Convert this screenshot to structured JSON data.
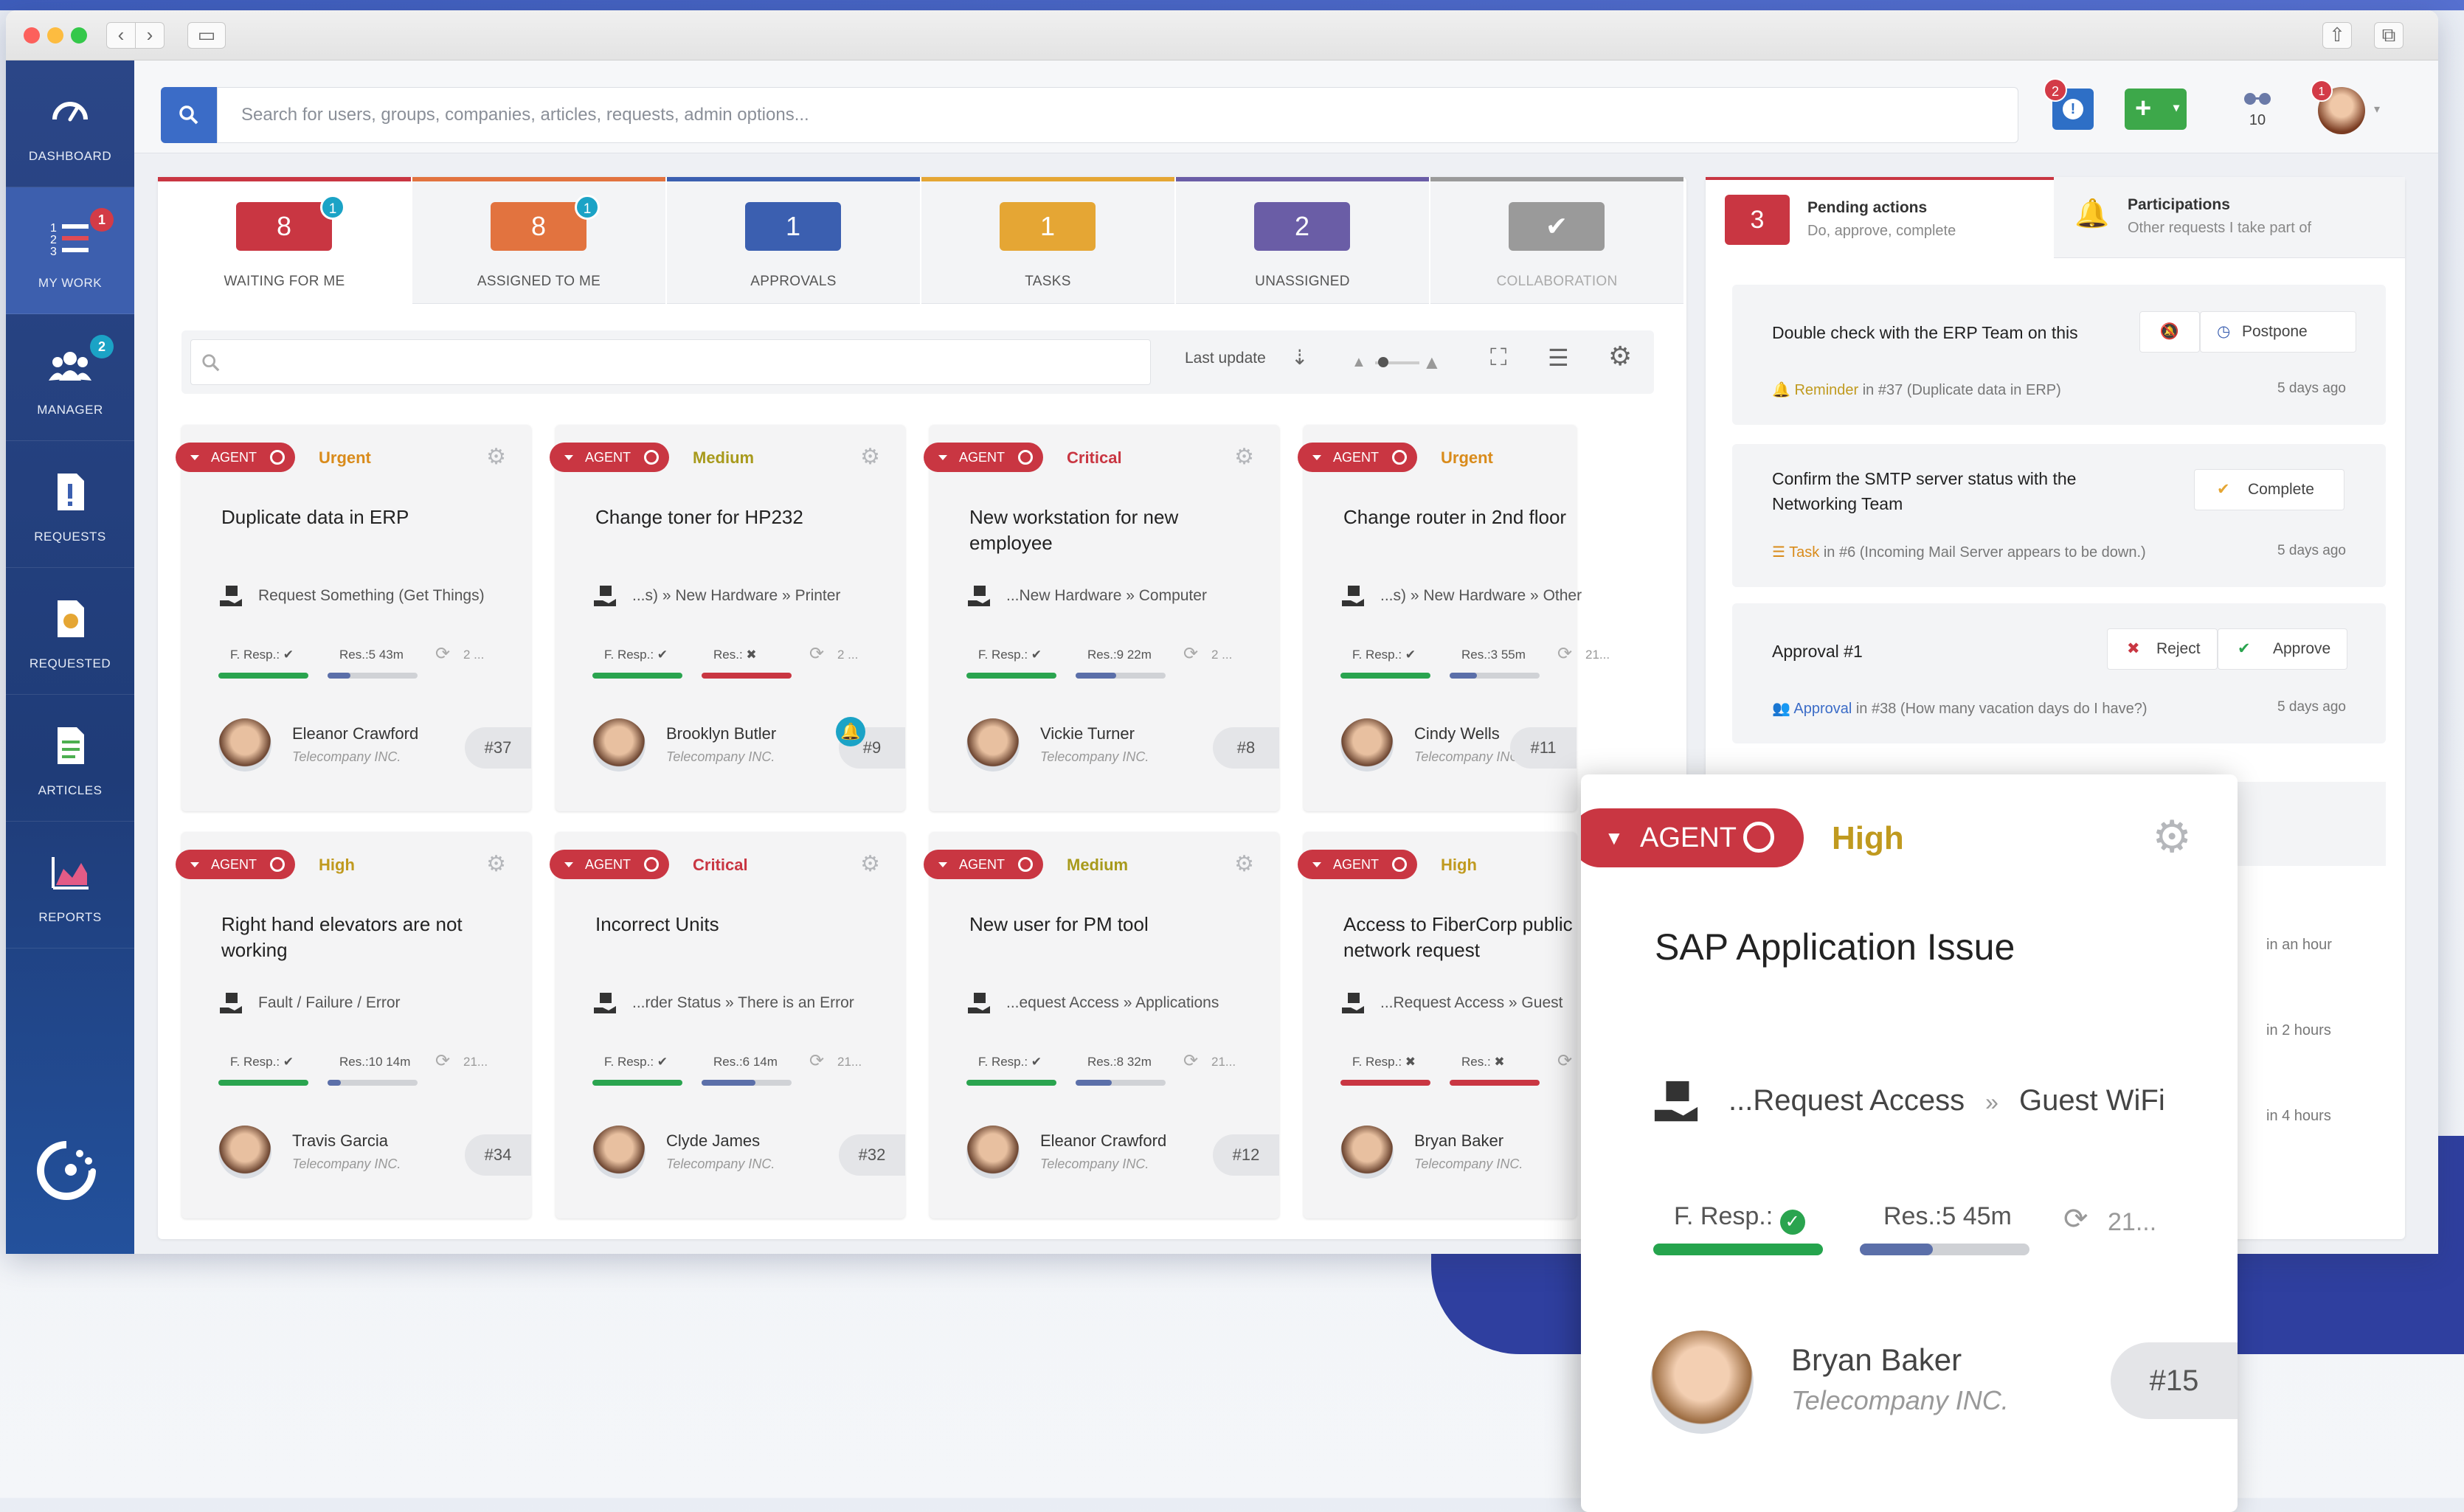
{
  "search": {
    "placeholder": "Search for users, groups, companies, articles, requests, admin options..."
  },
  "topbar": {
    "alert_badge": "2",
    "glasses_count": "10",
    "avatar_badge": "1"
  },
  "sidebar": {
    "items": [
      {
        "label": "DASHBOARD",
        "badge": ""
      },
      {
        "label": "MY WORK",
        "badge": "1"
      },
      {
        "label": "MANAGER",
        "badge": "2"
      },
      {
        "label": "REQUESTS",
        "badge": ""
      },
      {
        "label": "REQUESTED",
        "badge": ""
      },
      {
        "label": "ARTICLES",
        "badge": ""
      },
      {
        "label": "REPORTS",
        "badge": ""
      }
    ]
  },
  "tabs": [
    {
      "count": "8",
      "badge": "1",
      "label": "WAITING FOR ME",
      "color": "#c93642"
    },
    {
      "count": "8",
      "badge": "1",
      "label": "ASSIGNED TO ME",
      "color": "#e2733f"
    },
    {
      "count": "1",
      "badge": "",
      "label": "APPROVALS",
      "color": "#3b5fb0"
    },
    {
      "count": "1",
      "badge": "",
      "label": "TASKS",
      "color": "#e5a634"
    },
    {
      "count": "2",
      "badge": "",
      "label": "UNASSIGNED",
      "color": "#6a5da6"
    },
    {
      "count": "✔",
      "badge": "",
      "label": "COLLABORATION",
      "color": "#9a9a9a"
    }
  ],
  "filter": {
    "sort_label": "Last update"
  },
  "cards": [
    {
      "agent": "AGENT",
      "priority": "Urgent",
      "title": "Duplicate data in ERP",
      "path": "Request Something (Get Things)",
      "fresp": "F. Resp.: ✔",
      "res": "Res.:5 43m",
      "cycle": "2 ...",
      "name": "Eleanor Crawford",
      "company": "Telecompany INC.",
      "id": "#37"
    },
    {
      "agent": "AGENT",
      "priority": "Medium",
      "title": "Change toner for HP232",
      "path": "...s)  »  New Hardware  »  Printer",
      "fresp": "F. Resp.: ✔",
      "res": "Res.: ✖",
      "cycle": "2 ...",
      "name": "Brooklyn Butler",
      "company": "Telecompany INC.",
      "id": "#9"
    },
    {
      "agent": "AGENT",
      "priority": "Critical",
      "title": "New workstation for new employee",
      "path": "...New Hardware  »  Computer",
      "fresp": "F. Resp.: ✔",
      "res": "Res.:9 22m",
      "cycle": "2 ...",
      "name": "Vickie Turner",
      "company": "Telecompany INC.",
      "id": "#8"
    },
    {
      "agent": "AGENT",
      "priority": "Urgent",
      "title": "Change router in 2nd floor",
      "path": "...s)  »  New Hardware  »  Other",
      "fresp": "F. Resp.: ✔",
      "res": "Res.:3 55m",
      "cycle": "21...",
      "name": "Cindy Wells",
      "company": "Telecompany INC.",
      "id": "#11"
    },
    {
      "agent": "AGENT",
      "priority": "High",
      "title": "Right hand elevators are not working",
      "path": "Fault / Failure / Error",
      "fresp": "F. Resp.: ✔",
      "res": "Res.:10 14m",
      "cycle": "21...",
      "name": "Travis Garcia",
      "company": "Telecompany INC.",
      "id": "#34"
    },
    {
      "agent": "AGENT",
      "priority": "Critical",
      "title": "Incorrect Units",
      "path": "...rder Status  »  There is an Error",
      "fresp": "F. Resp.: ✔",
      "res": "Res.:6 14m",
      "cycle": "21...",
      "name": "Clyde James",
      "company": "Telecompany INC.",
      "id": "#32"
    },
    {
      "agent": "AGENT",
      "priority": "Medium",
      "title": "New user for PM tool",
      "path": "...equest Access  »  Applications",
      "fresp": "F. Resp.: ✔",
      "res": "Res.:8 32m",
      "cycle": "21...",
      "name": "Eleanor Crawford",
      "company": "Telecompany INC.",
      "id": "#12"
    },
    {
      "agent": "AGENT",
      "priority": "High",
      "title": "Access to FiberCorp public network request",
      "path": "...Request Access  »  Guest",
      "fresp": "F. Resp.: ✖",
      "res": "Res.: ✖",
      "cycle": "",
      "name": "Bryan Baker",
      "company": "Telecompany INC.",
      "id": ""
    }
  ],
  "right": {
    "tab1_count": "3",
    "tab1_title": "Pending actions",
    "tab1_sub": "Do, approve, complete",
    "tab2_title": "Participations",
    "tab2_sub": "Other requests I take part of",
    "items": [
      {
        "title": "Double check with the ERP Team on this",
        "btn1": "",
        "btn2": "Postpone",
        "type": "Reminder",
        "ref": "in #37 (Duplicate data in ERP)",
        "time": "5 days ago"
      },
      {
        "title": "Confirm the SMTP server status with the Networking Team",
        "btn1": "",
        "btn2": "Complete",
        "type": "Task",
        "ref": "in #6 (Incoming Mail Server appears to be down.)",
        "time": "5 days ago"
      },
      {
        "title": "Approval #1",
        "btn1": "Reject",
        "btn2": "Approve",
        "type": "Approval",
        "ref": "in #38 (How many vacation days do I have?)",
        "time": "5 days ago"
      }
    ],
    "times": [
      "in an hour",
      "in 2 hours",
      "in 4 hours"
    ]
  },
  "zoom": {
    "agent": "AGENT",
    "priority": "High",
    "title": "SAP Application Issue",
    "path1": "...Request Access",
    "path2": "Guest WiFi",
    "fresp": "F. Resp.:",
    "res": "Res.:5 45m",
    "cycle": "21...",
    "name": "Bryan Baker",
    "company": "Telecompany INC.",
    "id": "#15"
  }
}
